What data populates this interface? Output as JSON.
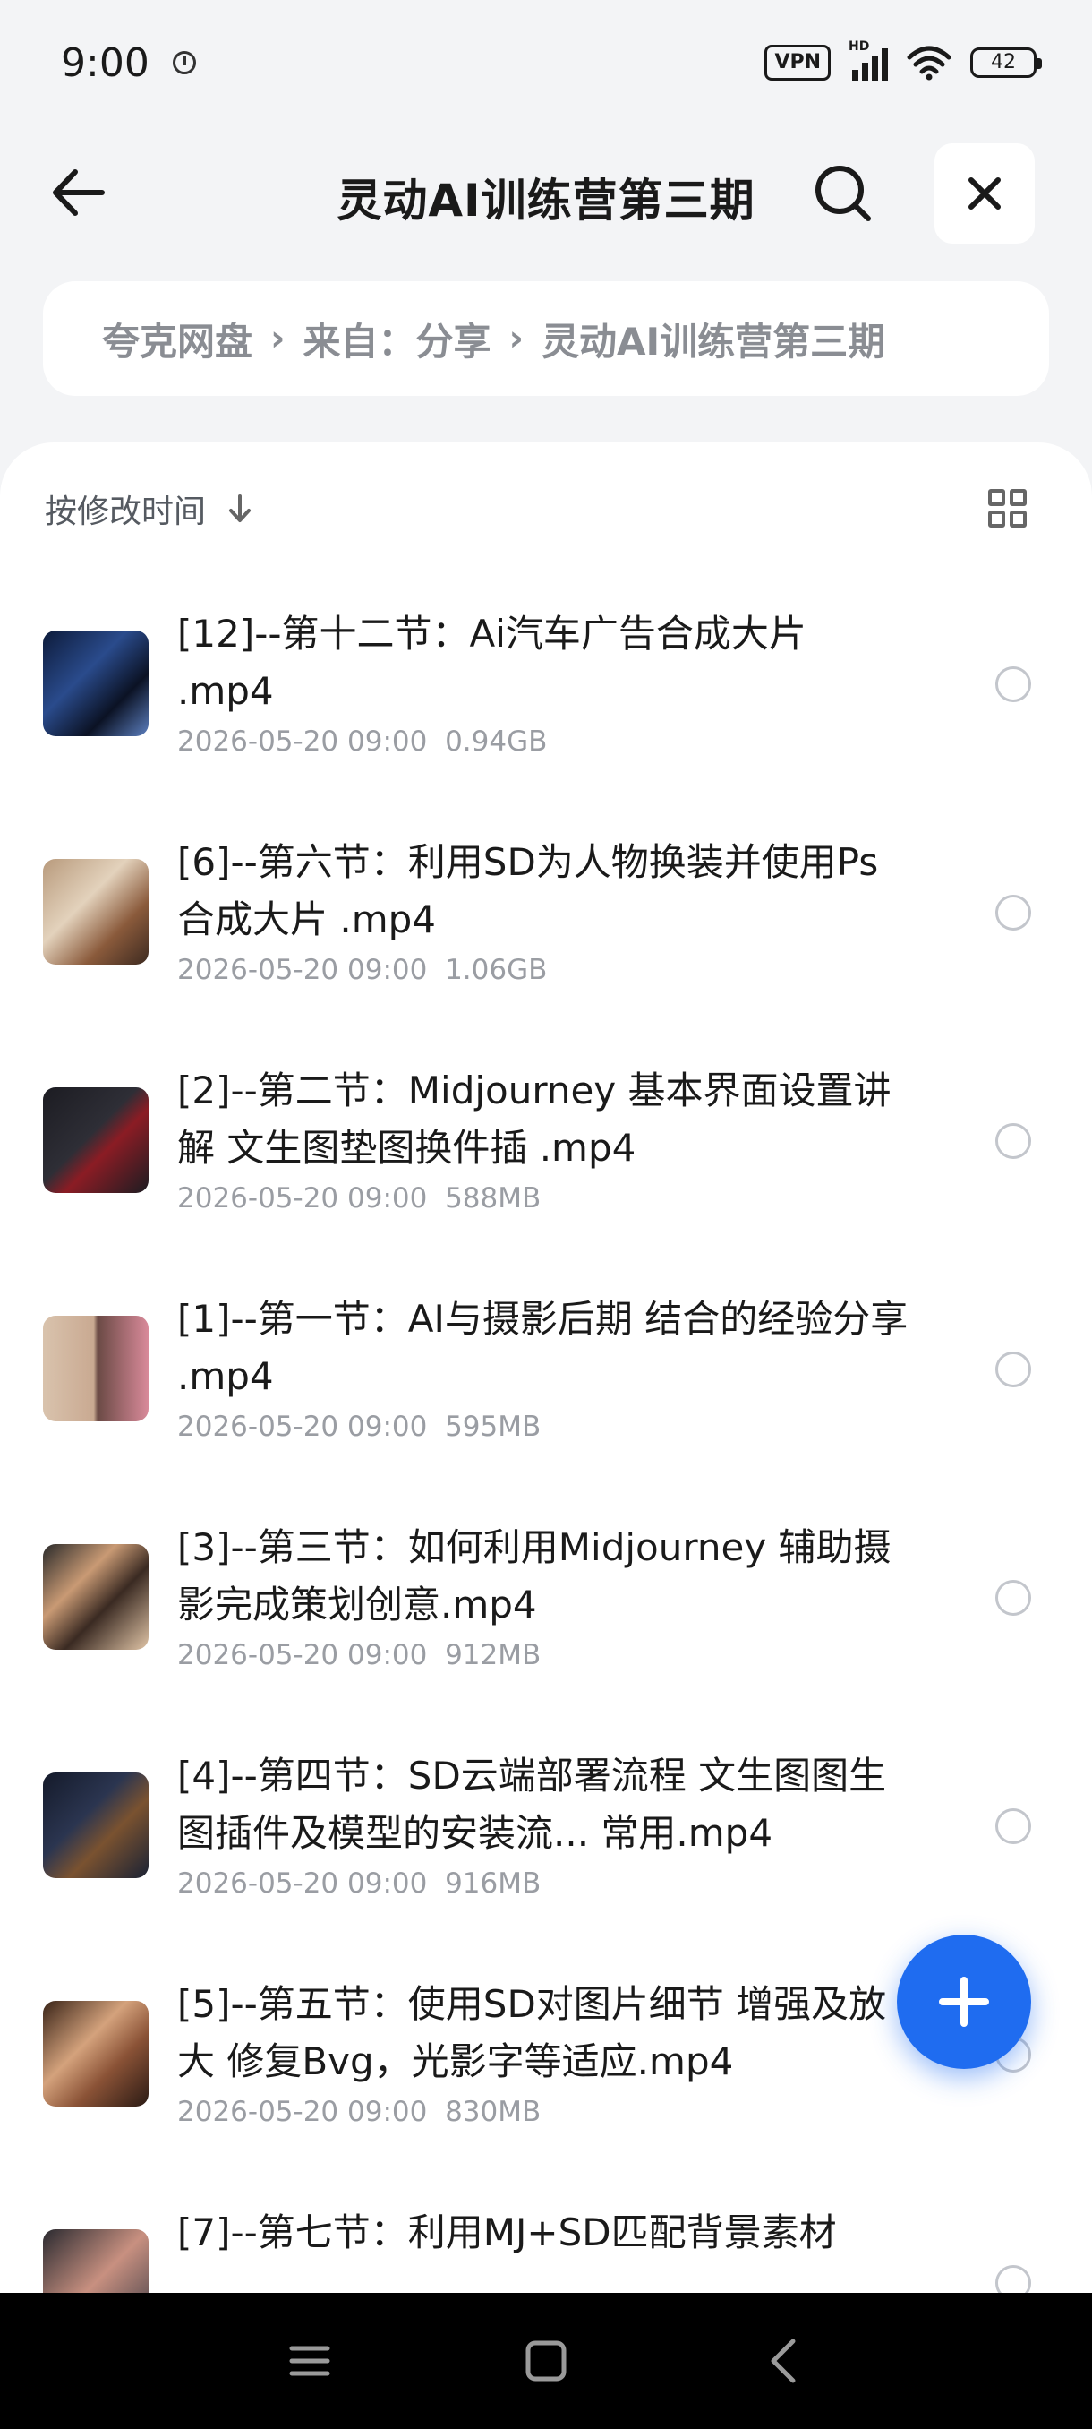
{
  "status_bar": {
    "time": "9:00",
    "vpn_label": "VPN",
    "network_label": "HD",
    "battery_level": "42"
  },
  "header": {
    "title": "灵动AI训练营第三期",
    "back_icon": "arrow-left-icon",
    "search_icon": "search-icon",
    "close_icon": "close-icon"
  },
  "breadcrumb": {
    "items": [
      "夸克网盘",
      "来自：分享",
      "灵动AI训练营第三期"
    ]
  },
  "toolbar": {
    "sort_label": "按修改时间",
    "sort_icon": "arrow-down-icon",
    "view_icon": "grid-view-icon"
  },
  "files": [
    {
      "name": "[12]--第十二节：Ai汽车广告合成大片 .mp4",
      "date": "2026-05-20 09:00",
      "size": "0.94GB"
    },
    {
      "name": "[6]--第六节：利用SD为人物换装并使用Ps合成大片 .mp4",
      "date": "2026-05-20 09:00",
      "size": "1.06GB"
    },
    {
      "name": "[2]--第二节：Midjourney 基本界面设置讲解 文生图垫图换件插 .mp4",
      "date": "2026-05-20 09:00",
      "size": "588MB"
    },
    {
      "name": "[1]--第一节：AI与摄影后期 结合的经验分享 .mp4",
      "date": "2026-05-20 09:00",
      "size": "595MB"
    },
    {
      "name": "[3]--第三节：如何利用Midjourney 辅助摄影完成策划创意.mp4",
      "date": "2026-05-20 09:00",
      "size": "912MB"
    },
    {
      "name": "[4]--第四节：SD云端部署流程 文生图图生图插件及模型的安装流... 常用.mp4",
      "date": "2026-05-20 09:00",
      "size": "916MB"
    },
    {
      "name": "[5]--第五节：使用SD对图片细节 增强及放大 修复Bvg，光影字等适应.mp4",
      "date": "2026-05-20 09:00",
      "size": "830MB"
    },
    {
      "name": "[7]--第七节：利用MJ+SD匹配背景素材",
      "date": "",
      "size": ""
    }
  ],
  "fab": {
    "icon": "plus-icon"
  },
  "colors": {
    "accent": "#1f6cf0",
    "background": "#f3f4f6",
    "muted_text": "#9a9da3"
  }
}
